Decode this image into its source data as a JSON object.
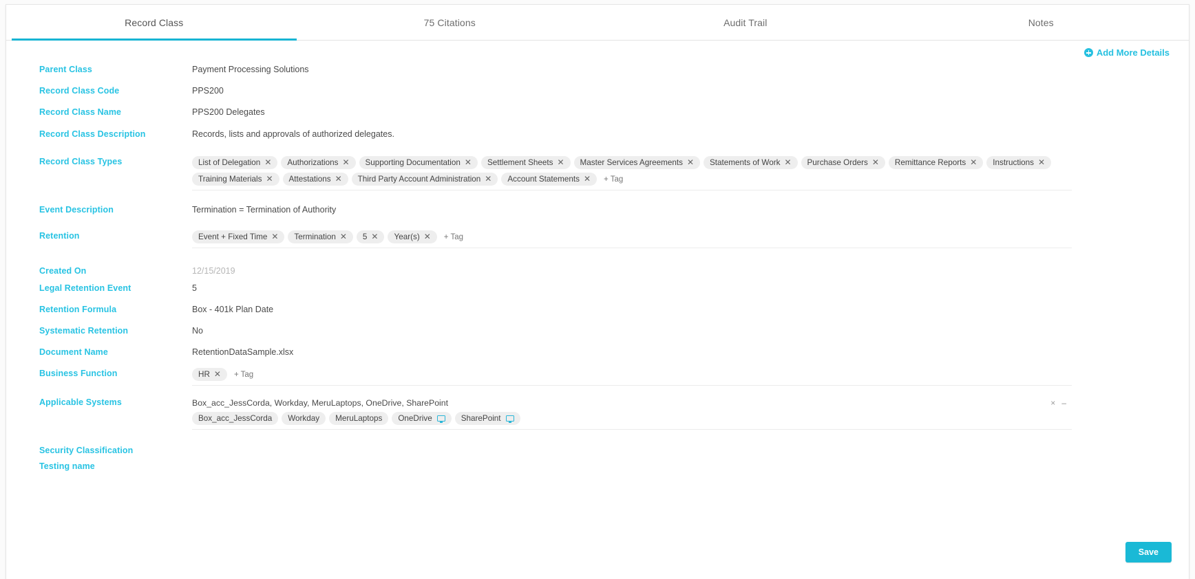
{
  "tabs": [
    {
      "label": "Record Class",
      "active": true
    },
    {
      "label": "75 Citations",
      "active": false
    },
    {
      "label": "Audit Trail",
      "active": false
    },
    {
      "label": "Notes",
      "active": false
    }
  ],
  "toolbar": {
    "add_more_details_label": "Add More Details"
  },
  "fields": {
    "parent_class": {
      "label": "Parent Class",
      "value": "Payment Processing Solutions"
    },
    "record_class_code": {
      "label": "Record Class Code",
      "value": "PPS200"
    },
    "record_class_name": {
      "label": "Record Class Name",
      "value": "PPS200 Delegates"
    },
    "record_class_description": {
      "label": "Record Class Description",
      "value": "Records, lists and approvals of authorized delegates."
    },
    "record_class_types": {
      "label": "Record Class Types",
      "tags": [
        "List of Delegation",
        "Authorizations",
        "Supporting Documentation",
        "Settlement Sheets",
        "Master Services Agreements",
        "Statements of Work",
        "Purchase Orders",
        "Remittance Reports",
        "Instructions",
        "Training Materials",
        "Attestations",
        "Third Party Account Administration",
        "Account Statements"
      ],
      "add_tag_label": "+ Tag"
    },
    "event_description": {
      "label": "Event Description",
      "value": "Termination = Termination of Authority"
    },
    "retention": {
      "label": "Retention",
      "tags": [
        "Event + Fixed Time",
        "Termination",
        "5",
        "Year(s)"
      ],
      "add_tag_label": "+ Tag"
    },
    "created_on": {
      "label": "Created On",
      "value": "12/15/2019"
    },
    "legal_retention_event": {
      "label": "Legal Retention Event",
      "value": "5"
    },
    "retention_formula": {
      "label": "Retention Formula",
      "value": "Box - 401k Plan Date"
    },
    "systematic_retention": {
      "label": "Systematic Retention",
      "value": "No"
    },
    "document_name": {
      "label": "Document Name",
      "value": "RetentionDataSample.xlsx"
    },
    "business_function": {
      "label": "Business Function",
      "tags": [
        "HR"
      ],
      "add_tag_label": "+ Tag"
    },
    "applicable_systems": {
      "label": "Applicable Systems",
      "summary": "Box_acc_JessCorda, Workday, MeruLaptops, OneDrive, SharePoint",
      "chips": [
        {
          "label": "Box_acc_JessCorda",
          "icon": false
        },
        {
          "label": "Workday",
          "icon": false
        },
        {
          "label": "MeruLaptops",
          "icon": false
        },
        {
          "label": "OneDrive",
          "icon": true
        },
        {
          "label": "SharePoint",
          "icon": true
        }
      ],
      "clear_icon": "×",
      "dash_icon": "–"
    },
    "security_classification": {
      "label": "Security Classification",
      "value": ""
    },
    "testing_name": {
      "label": "Testing name",
      "value": ""
    }
  },
  "footer": {
    "save_label": "Save"
  },
  "colors": {
    "accent": "#28c3e3",
    "tab_underline": "#17b4d3",
    "save_button": "#1ab9d6",
    "tag_bg": "#eeeeee",
    "label_text": "#28c3e3",
    "value_text": "#4a4a4a",
    "muted_text": "#b6b6b6"
  }
}
